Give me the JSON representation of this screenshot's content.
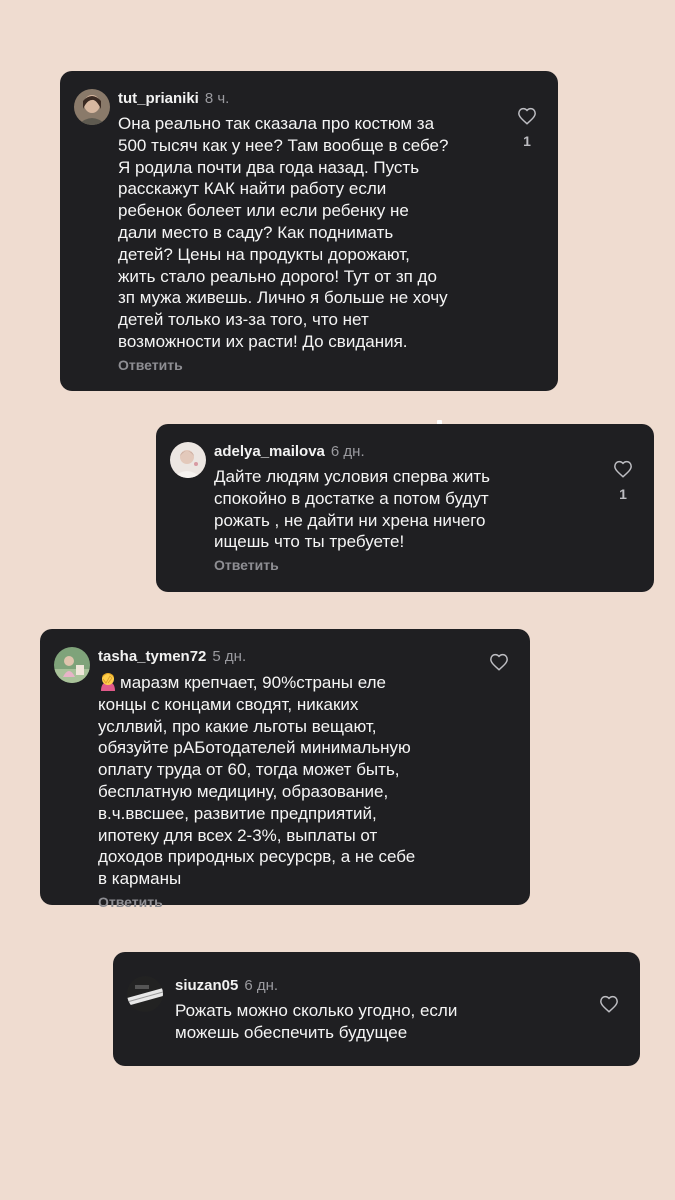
{
  "comments": [
    {
      "username": "tut_prianiki",
      "time": "8 ч.",
      "text": "Она реально так сказала про костюм за\n500 тысяч как у нее? Там вообще в себе?\nЯ родила почти два года назад. Пусть\nрасскажут КАК найти работу если\nребенок болеет или если ребенку не\nдали место в саду? Как поднимать\nдетей? Цены на продукты дорожают,\nжить стало реально дорого! Тут от зп до\nзп мужа живешь. Лично я больше не хочу\nдетей только из-за того, что нет\nвозможности их расти! До свидания.",
      "reply": "Ответить",
      "likes": "1"
    },
    {
      "username": "adelya_mailova",
      "time": "6 дн.",
      "text": "Дайте людям условия сперва жить\nспокойно в достатке а потом будут\nрожать , не дайти ни хрена ничего\nищешь что ты требуете!",
      "reply": "Ответить",
      "likes": "1"
    },
    {
      "username": "tasha_tymen72",
      "time": "5 дн.",
      "emoji": "person-facepalming-emoji",
      "text": "маразм крепчает, 90%страны еле\nконцы с концами сводят, никаких\nусллвий, про какие льготы вещают,\nобязуйте рАБотодателей минимальную\nоплату труда от 60, тогда может быть,\nбесплатную медицину, образование,\nв.ч.ввсшее, развитие предприятий,\nипотеку для всех 2-3%, выплаты от\nдоходов природных ресурсрв, а не себе\nв карманы",
      "reply": "Ответить"
    },
    {
      "username": "siuzan05",
      "time": "6 дн.",
      "text": "Рожать можно сколько угодно, если\nможешь обеспечить будущее"
    }
  ],
  "colors": {
    "background": "#efdcd0",
    "card": "#1f1f22",
    "text": "#f5f5f5",
    "muted": "#8e8e93"
  },
  "icons": {
    "like": "heart-outline-icon"
  }
}
